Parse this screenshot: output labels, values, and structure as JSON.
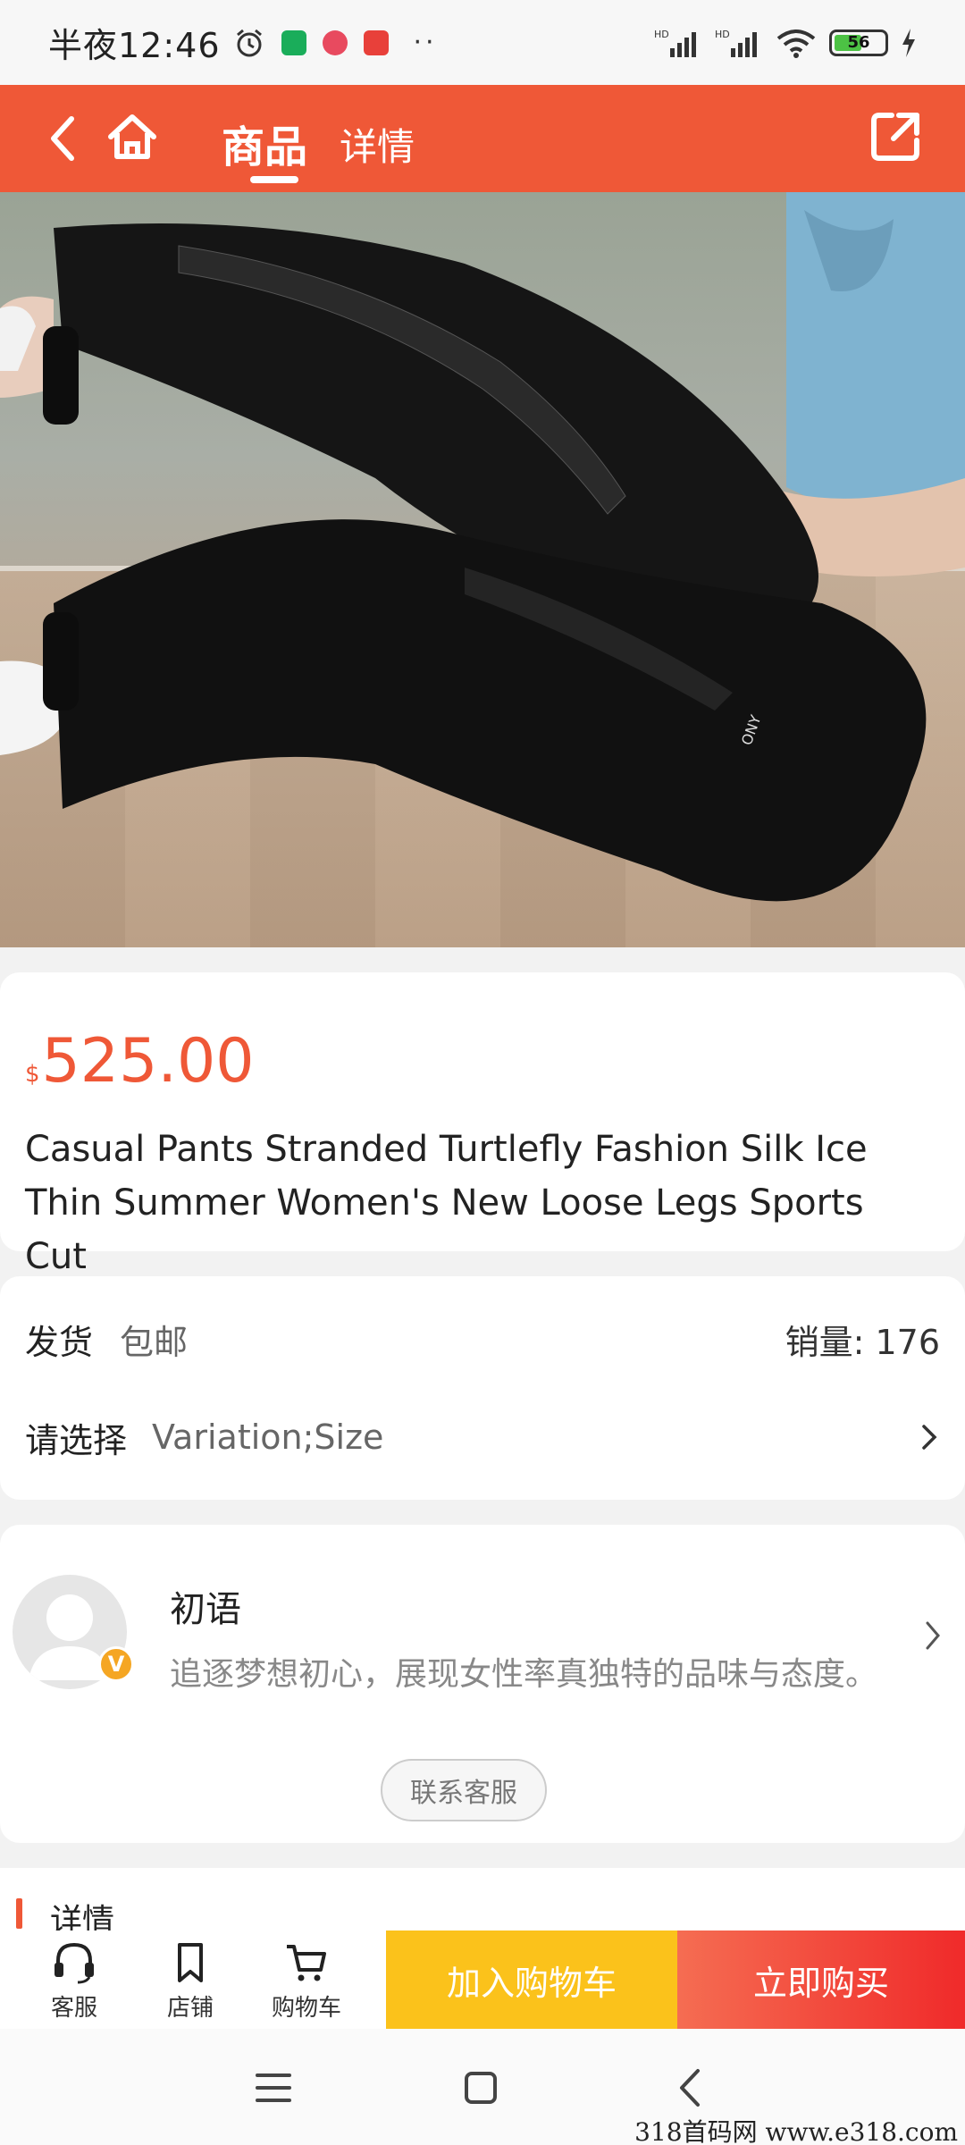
{
  "status_bar": {
    "time": "半夜12:46",
    "dots": "··",
    "battery": "56",
    "battery_level_percent": 56
  },
  "header": {
    "tab_goods": "商品",
    "tab_detail": "详情",
    "accent_color": "#ef5837"
  },
  "product": {
    "currency": "$",
    "price": "525.00",
    "title": "Casual Pants Stranded Turtlefly Fashion Silk Ice Thin Summer Women's New Loose Legs Sports Cut"
  },
  "shipping": {
    "label": "发货",
    "value": "包邮",
    "sales": "销量: 176"
  },
  "selection": {
    "label": "请选择",
    "value": "Variation;Size"
  },
  "shop": {
    "badge": "V",
    "name": "初语",
    "description": "追逐梦想初心，展现女性率真独特的品味与态度。",
    "contact_button": "联系客服"
  },
  "details": {
    "title": "详情"
  },
  "action_bar": {
    "service": "客服",
    "store": "店铺",
    "cart": "购物车",
    "add_to_cart": "加入购物车",
    "buy_now": "立即购买"
  },
  "watermark": "318首码网 www.e318.com"
}
